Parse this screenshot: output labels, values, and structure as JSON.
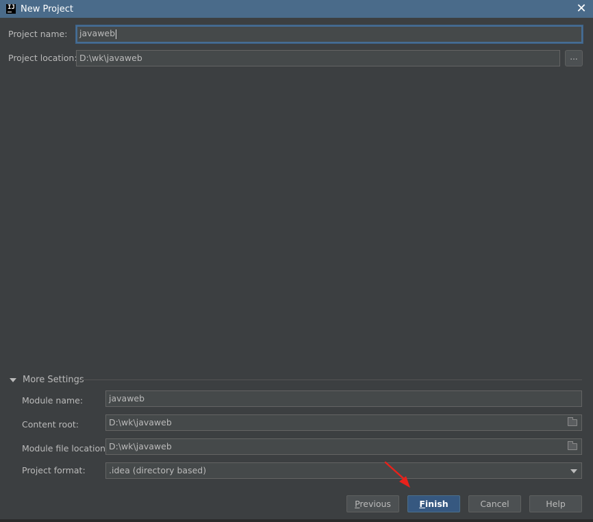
{
  "window": {
    "title": "New Project",
    "app_icon_text": "IJ",
    "close_glyph": "✕"
  },
  "project": {
    "name_label": "Project name:",
    "name_value": "javaweb",
    "location_label": "Project location:",
    "location_value": "D:\\wk\\javaweb",
    "browse_label": "..."
  },
  "more_settings": {
    "toggle_label": "More Settings",
    "module_name_label": "Module name:",
    "module_name_value": "javaweb",
    "content_root_label": "Content root:",
    "content_root_value": "D:\\wk\\javaweb",
    "module_file_location_label": "Module file location:",
    "module_file_location_value": "D:\\wk\\javaweb",
    "project_format_label": "Project format:",
    "project_format_value": ".idea (directory based)"
  },
  "buttons": {
    "previous_mnemonic": "P",
    "previous_rest": "revious",
    "finish_mnemonic": "F",
    "finish_rest": "inish",
    "cancel": "Cancel",
    "help": "Help"
  },
  "colors": {
    "background": "#3c3f41",
    "titlebar": "#4a6b8a",
    "primary_button": "#365880",
    "annotation_arrow": "#e8221b"
  },
  "icons": {
    "app": "intellij-icon",
    "close": "close-icon",
    "folder": "folder-icon",
    "expand": "triangle-down-icon",
    "dropdown": "chevron-down-icon",
    "annotation": "red-arrow-icon"
  }
}
